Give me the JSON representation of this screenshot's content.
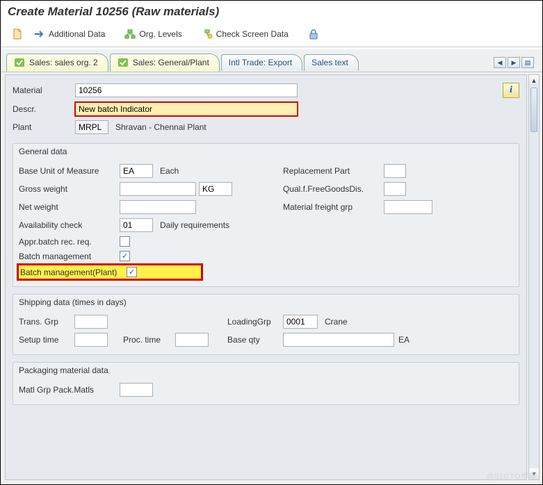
{
  "title": "Create Material 10256 (Raw materials)",
  "toolbar": {
    "additional_data": "Additional Data",
    "org_levels": "Org. Levels",
    "check_screen": "Check Screen Data"
  },
  "tabs": {
    "t1": "Sales: sales org. 2",
    "t2": "Sales: General/Plant",
    "t3": "Intl Trade: Export",
    "t4": "Sales text"
  },
  "header": {
    "material_lbl": "Material",
    "material_val": "10256",
    "descr_lbl": "Descr.",
    "descr_val": "New batch Indicator",
    "plant_lbl": "Plant",
    "plant_val": "MRPL",
    "plant_text": "Shravan - Chennai Plant"
  },
  "general": {
    "title": "General data",
    "buom_lbl": "Base Unit of Measure",
    "buom_val": "EA",
    "buom_txt": "Each",
    "gross_lbl": "Gross weight",
    "gross_val": "",
    "gross_unit": "KG",
    "net_lbl": "Net weight",
    "net_val": "",
    "avail_lbl": "Availability check",
    "avail_val": "01",
    "avail_txt": "Daily requirements",
    "appr_lbl": "Appr.batch rec. req.",
    "batch_lbl": "Batch management",
    "batch_plant_lbl": "Batch management(Plant)",
    "repl_lbl": "Replacement Part",
    "repl_val": "",
    "qual_lbl": "Qual.f.FreeGoodsDis.",
    "qual_val": "",
    "mfrg_lbl": "Material freight grp",
    "mfrg_val": ""
  },
  "shipping": {
    "title": "Shipping data (times in days)",
    "trans_lbl": "Trans. Grp",
    "trans_val": "",
    "loadg_lbl": "LoadingGrp",
    "loadg_val": "0001",
    "loadg_txt": "Crane",
    "setup_lbl": "Setup time",
    "setup_val": "",
    "proc_lbl": "Proc. time",
    "proc_val": "",
    "base_lbl": "Base qty",
    "base_val": "",
    "base_unit": "EA"
  },
  "packaging": {
    "title": "Packaging material data",
    "mgpm_lbl": "Matl Grp Pack.Matls",
    "mgpm_val": ""
  },
  "watermark": "@51CTO博客"
}
